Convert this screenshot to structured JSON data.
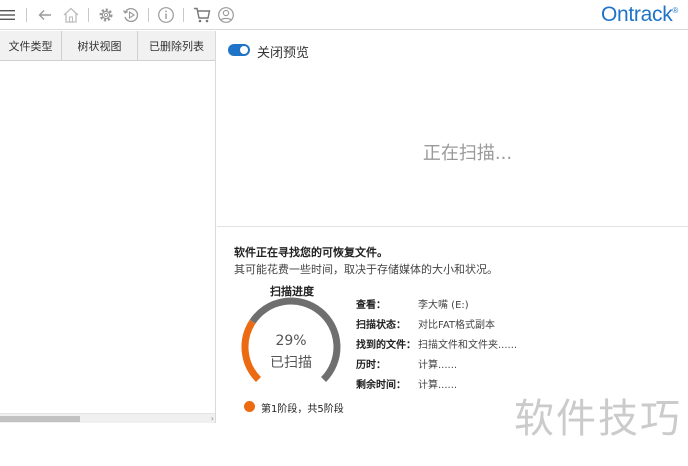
{
  "toolbar": {
    "icons": [
      "menu-icon",
      "back-icon",
      "home-icon",
      "settings-icon",
      "history-icon",
      "info-icon",
      "cart-icon",
      "user-icon"
    ]
  },
  "brand": {
    "name": "Ontrack",
    "mark": "®",
    "color": "#1f74c7"
  },
  "left_pane": {
    "tabs": [
      {
        "label": "文件类型"
      },
      {
        "label": "树状视图"
      },
      {
        "label": "已删除列表"
      }
    ]
  },
  "preview": {
    "toggle_label": "关闭预览",
    "toggle_on": true,
    "status": "正在扫描..."
  },
  "scan": {
    "title": "软件正在寻找您的可恢复文件。",
    "subtitle": "其可能花费一些时间，取决于存储媒体的大小和状况。",
    "progress_title": "扫描进度",
    "progress_percent": 29,
    "progress_text": "29%",
    "progress_label": "已扫描",
    "stage_text": "第1阶段，共5阶段",
    "accent_color": "#ec6a12",
    "track_color": "#6f6f6f",
    "details": [
      {
        "key": "查看：",
        "value": "李大嘴 (E:)"
      },
      {
        "key": "扫描状态：",
        "value": "对比FAT格式副本"
      },
      {
        "key": "找到的文件：",
        "value": "扫描文件和文件夹......"
      },
      {
        "key": "历时：",
        "value": "计算......"
      },
      {
        "key": "剩余时间：",
        "value": "计算......"
      }
    ]
  },
  "watermark": "软件技巧"
}
